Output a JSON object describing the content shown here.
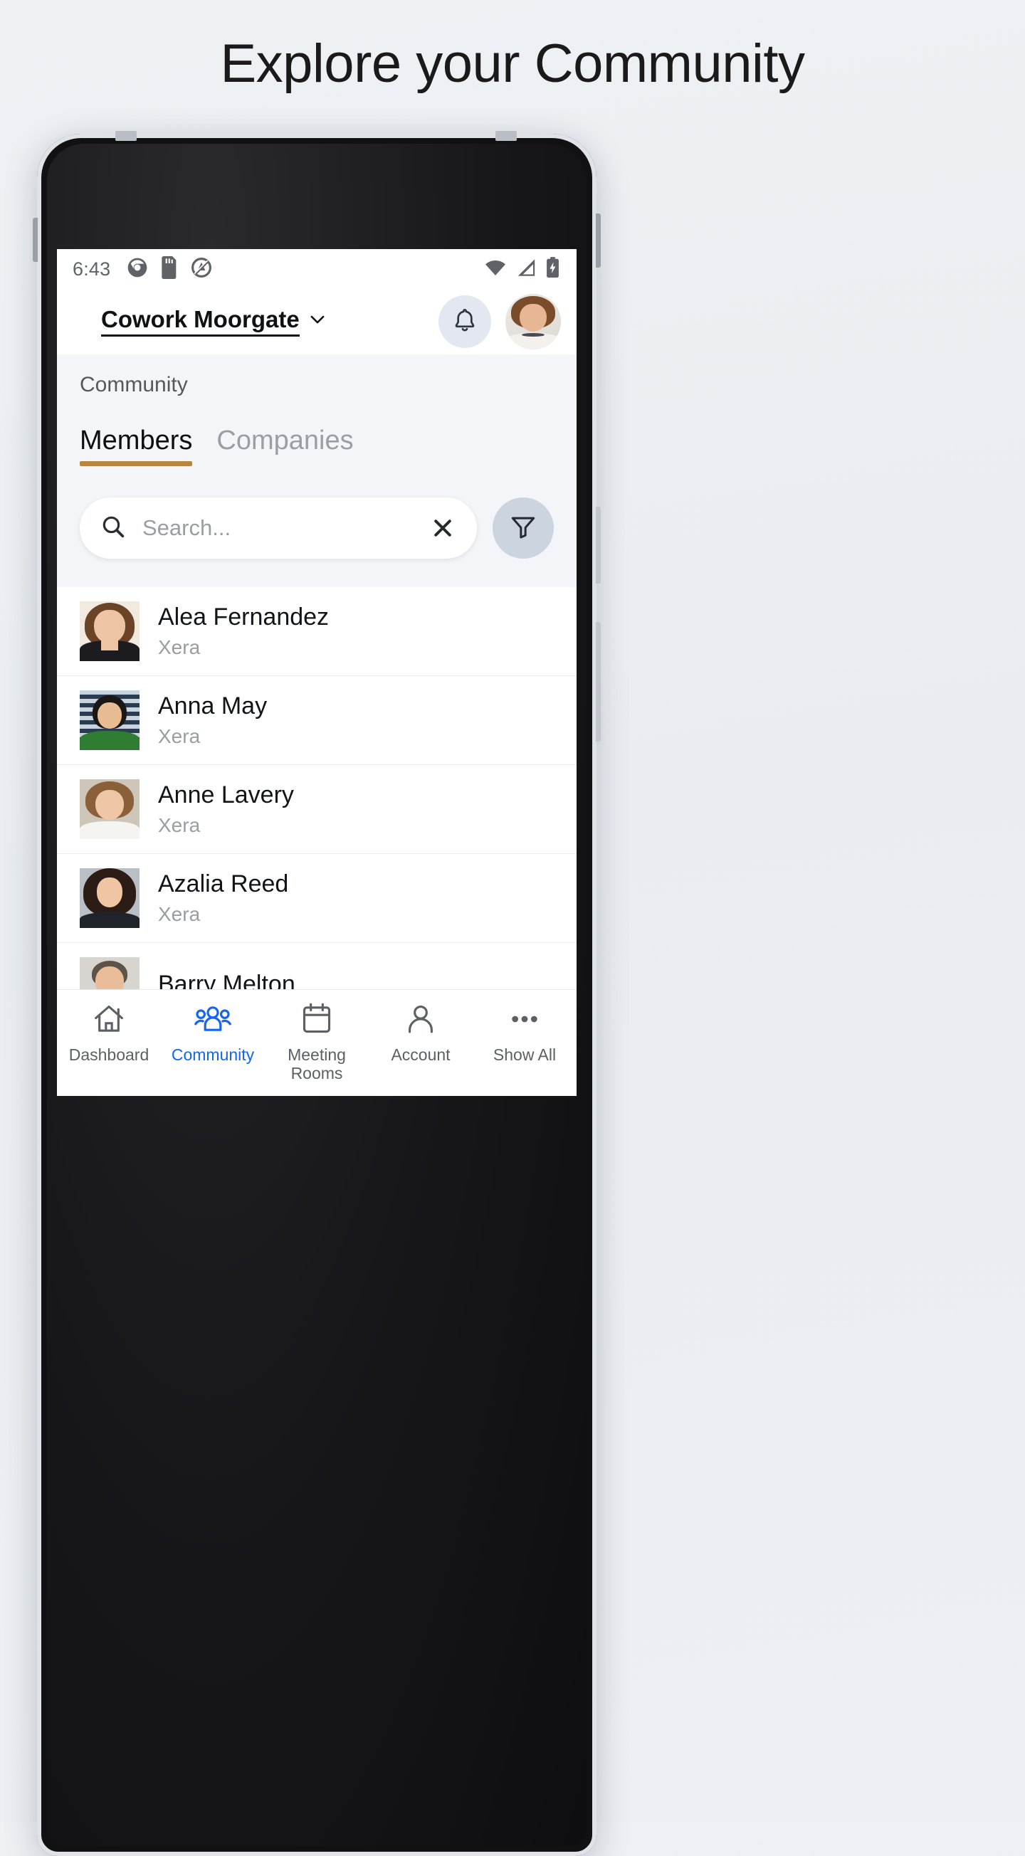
{
  "promo": {
    "headline": "Explore your Community"
  },
  "status_bar": {
    "time": "6:43",
    "left_icons": [
      "aperture-icon",
      "sd-card-icon",
      "privacy-icon"
    ],
    "right_icons": [
      "wifi-icon",
      "cellular-signal-icon",
      "battery-charging-icon"
    ]
  },
  "app_bar": {
    "venue_name": "Cowork Moorgate",
    "venue_chevron": "chevron-down-icon",
    "notification_icon": "bell-icon",
    "profile_avatar": "avatar"
  },
  "section": {
    "label": "Community",
    "tabs": [
      {
        "label": "Members",
        "active": true
      },
      {
        "label": "Companies",
        "active": false
      }
    ]
  },
  "search": {
    "placeholder": "Search...",
    "value": "",
    "search_icon": "search-icon",
    "clear_icon": "close-icon",
    "filter_icon": "filter-icon"
  },
  "members": [
    {
      "name": "Alea Fernandez",
      "company": "Xera"
    },
    {
      "name": "Anna May",
      "company": "Xera"
    },
    {
      "name": "Anne Lavery",
      "company": "Xera"
    },
    {
      "name": "Azalia Reed",
      "company": "Xera"
    },
    {
      "name": "Barry Melton",
      "company": ""
    }
  ],
  "bottom_nav": [
    {
      "label": "Dashboard",
      "icon": "home-icon",
      "active": false
    },
    {
      "label": "Community",
      "icon": "people-group-icon",
      "active": true
    },
    {
      "label": "Meeting Rooms",
      "icon": "calendar-icon",
      "active": false
    },
    {
      "label": "Account",
      "icon": "person-icon",
      "active": false
    },
    {
      "label": "Show All",
      "icon": "ellipsis-icon",
      "active": false
    }
  ],
  "colors": {
    "accent_tab": "#b9863f",
    "active_nav": "#1565f0",
    "page_background": "#eef1f4",
    "section_background": "#f3f5f8",
    "filter_button": "#ccd4df",
    "bell_button": "#e3e8f0"
  }
}
